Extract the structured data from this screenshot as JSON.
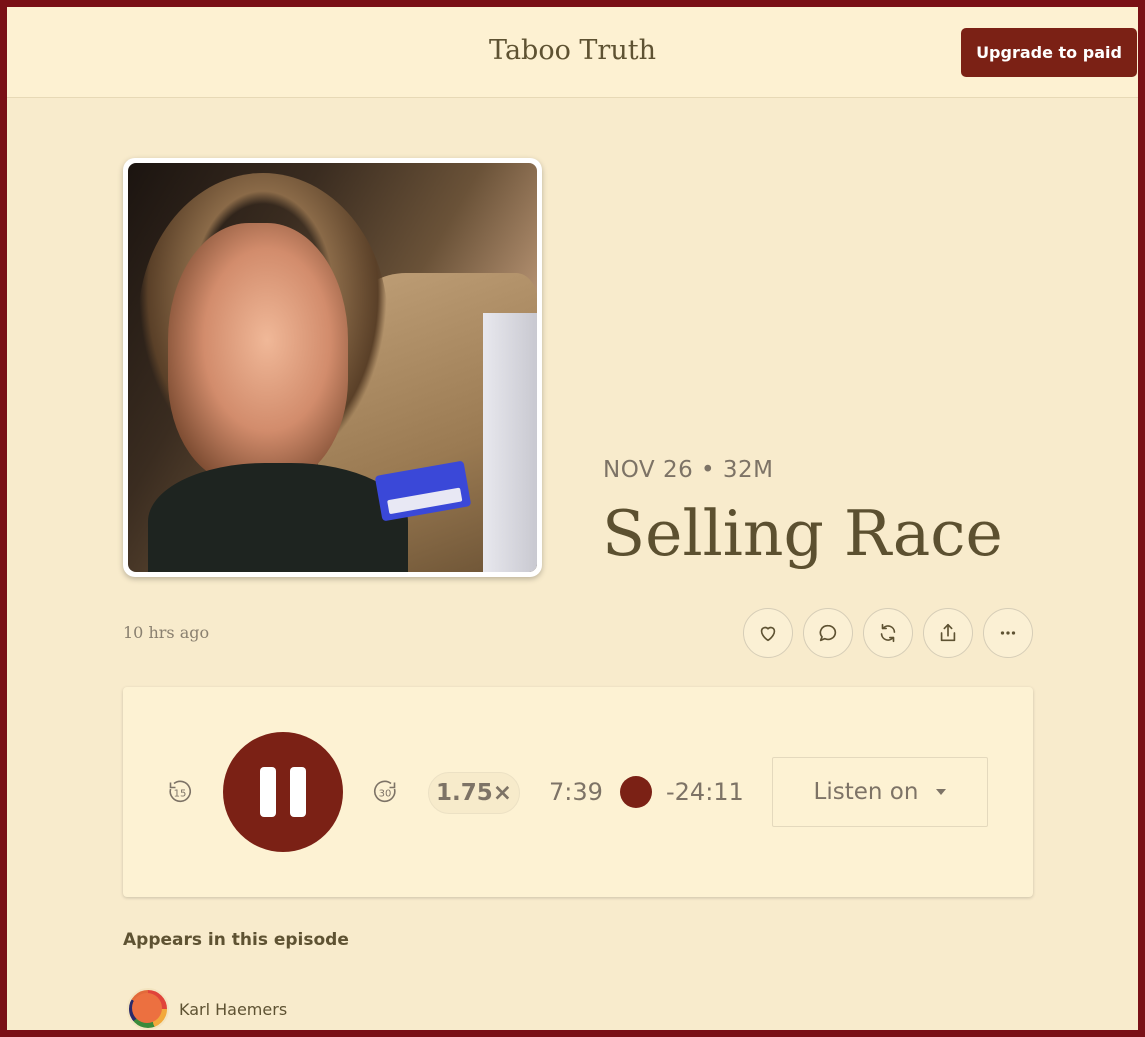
{
  "header": {
    "publication_title": "Taboo Truth",
    "upgrade_label": "Upgrade to paid"
  },
  "episode": {
    "meta": "NOV 26 • 32M",
    "title": "Selling Race",
    "time_ago": "10 hrs ago"
  },
  "actions": [
    {
      "name": "like-button",
      "icon": "heart-icon"
    },
    {
      "name": "comment-button",
      "icon": "comment-icon"
    },
    {
      "name": "restack-button",
      "icon": "restack-icon"
    },
    {
      "name": "share-button",
      "icon": "share-icon"
    },
    {
      "name": "more-button",
      "icon": "ellipsis-icon"
    }
  ],
  "player": {
    "skip_back": "15",
    "skip_forward": "30",
    "speed": "1.75×",
    "elapsed": "7:39",
    "remaining": "-24:11",
    "listen_on_label": "Listen on",
    "state": "playing"
  },
  "appears": {
    "heading": "Appears in this episode",
    "people": [
      "Karl Haemers"
    ]
  },
  "colors": {
    "accent": "#7b2115",
    "background": "#f8ebcc",
    "header_bg": "#fdf1d2",
    "frame": "#7a1016"
  }
}
